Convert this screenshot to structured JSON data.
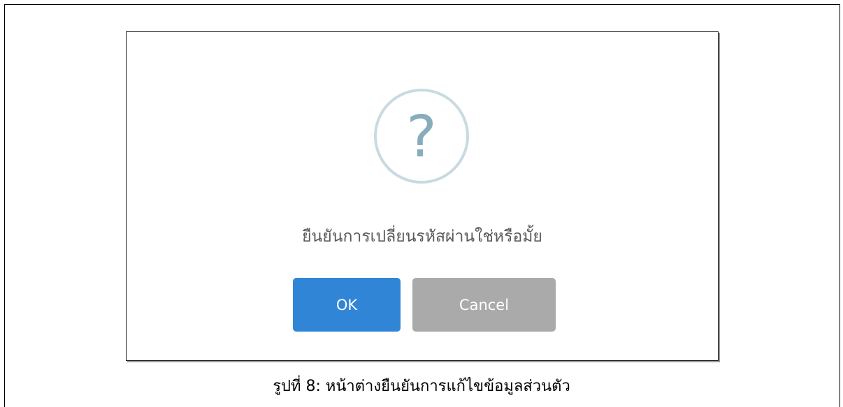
{
  "dialog": {
    "icon": "question-mark-icon",
    "icon_glyph": "?",
    "message": "ยืนยันการเปลี่ยนรหัสผ่านใช่หรือมั้ย",
    "ok_label": "OK",
    "cancel_label": "Cancel"
  },
  "caption": "รูปที่ 8: หน้าต่างยืนยันการแก้ไขข้อมูลส่วนตัว",
  "colors": {
    "ok_button": "#3085d6",
    "cancel_button": "#aaaaaa",
    "icon_ring": "#c9dae1",
    "icon_glyph": "#87adbd",
    "message_text": "#595959"
  }
}
